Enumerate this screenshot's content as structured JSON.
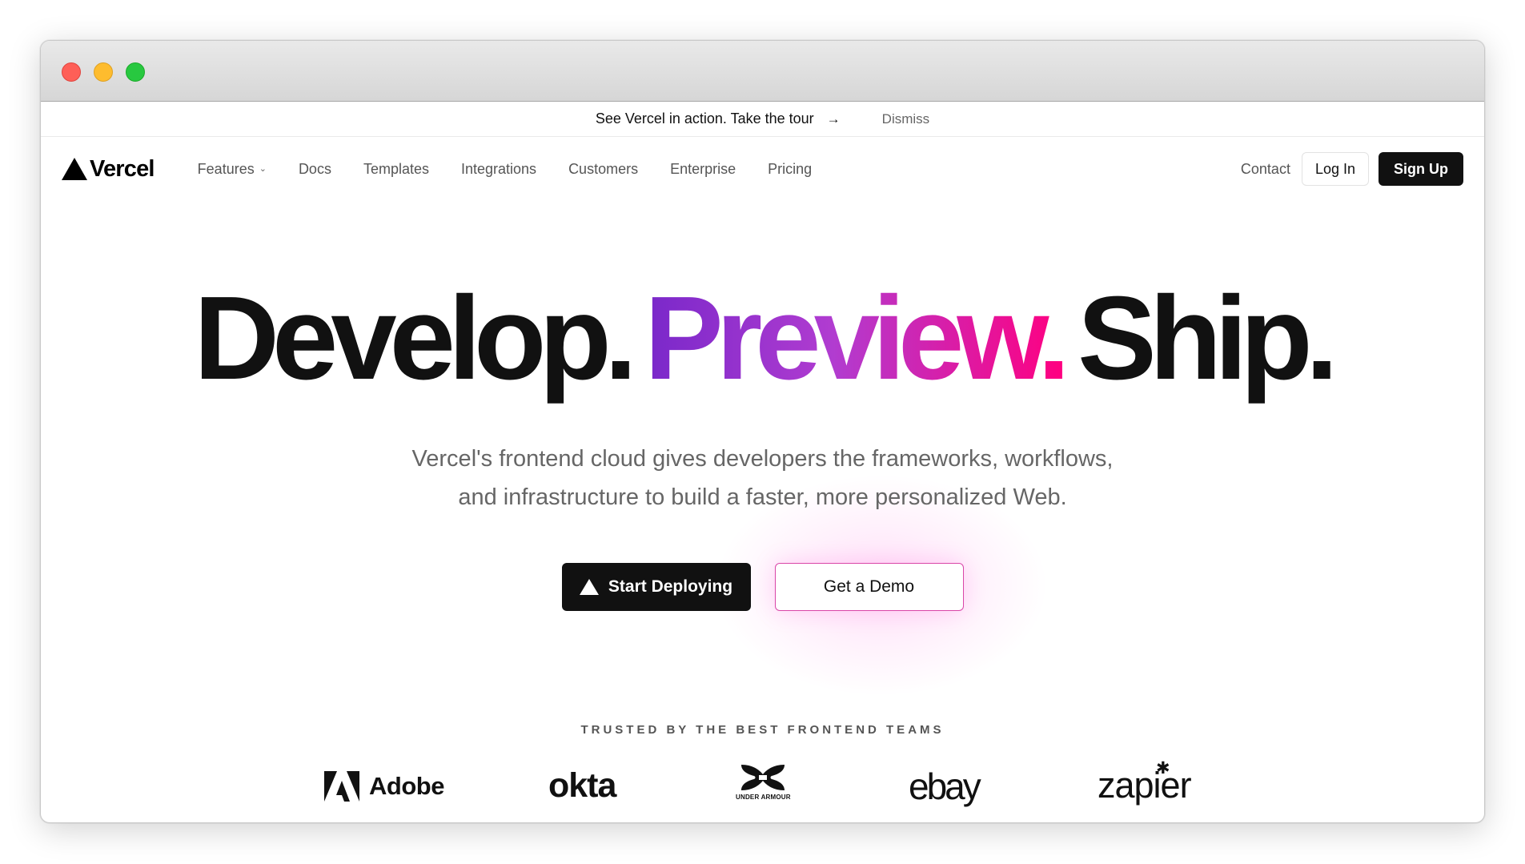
{
  "window": {
    "controls": [
      "close",
      "minimize",
      "zoom"
    ]
  },
  "banner": {
    "text": "See Vercel in action. Take the tour",
    "arrow": "→",
    "dismiss": "Dismiss"
  },
  "nav": {
    "logo_text": "Vercel",
    "links": [
      "Features",
      "Docs",
      "Templates",
      "Integrations",
      "Customers",
      "Enterprise",
      "Pricing"
    ],
    "contact": "Contact",
    "login": "Log In",
    "signup": "Sign Up"
  },
  "hero": {
    "headline": [
      "Develop.",
      "Preview.",
      "Ship."
    ],
    "subtitle_line1": "Vercel's frontend cloud gives developers the frameworks, workflows,",
    "subtitle_line2": "and infrastructure to build a faster, more personalized Web.",
    "primary_cta": "Start Deploying",
    "secondary_cta": "Get a Demo"
  },
  "trusted": {
    "label": "TRUSTED BY THE BEST FRONTEND TEAMS",
    "brands": [
      "Adobe",
      "okta",
      "UNDER ARMOUR",
      "ebay",
      "zapier"
    ]
  },
  "colors": {
    "accent_gradient_start": "#7928ca",
    "accent_gradient_end": "#ff0080",
    "primary_dark": "#111111"
  }
}
